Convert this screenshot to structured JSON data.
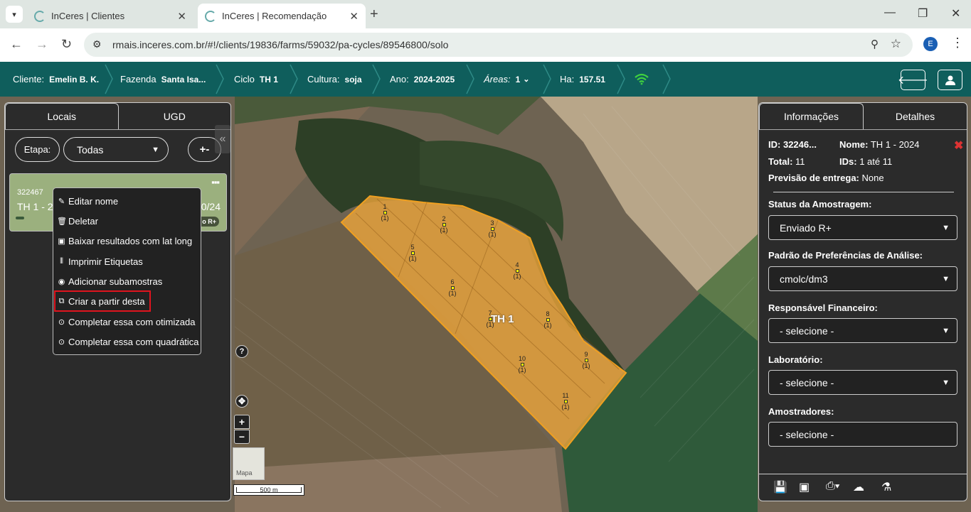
{
  "browser": {
    "tabs": [
      {
        "title": "InCeres | Clientes"
      },
      {
        "title": "InCeres | Recomendação"
      }
    ],
    "url": "rmais.inceres.com.br/#!/clients/19836/farms/59032/pa-cycles/89546800/solo",
    "profile_initial": "E"
  },
  "header": {
    "cliente_label": "Cliente:",
    "cliente_value": "Emelin B. K.",
    "fazenda_label": "Fazenda",
    "fazenda_value": "Santa Isa...",
    "ciclo_label": "Ciclo",
    "ciclo_value": "TH 1",
    "cultura_label": "Cultura:",
    "cultura_value": "soja",
    "ano_label": "Ano:",
    "ano_value": "2024-2025",
    "areas_label": "Áreas:",
    "areas_value": "1",
    "ha_label": "Ha:",
    "ha_value": "157.51"
  },
  "left_panel": {
    "tabs": [
      "Locais",
      "UGD"
    ],
    "etapa_label": "Etapa:",
    "etapa_select": "Todas",
    "plus_label": "+-",
    "card": {
      "id": "322467",
      "name": "TH 1 - 20",
      "date": "0/24",
      "badge": "o R+"
    }
  },
  "context_menu": {
    "items": [
      {
        "label": "Editar nome",
        "icon": "pencil-icon"
      },
      {
        "label": "Deletar",
        "icon": "trash-icon"
      },
      {
        "label": "Baixar resultados com lat long",
        "icon": "excel-file-icon"
      },
      {
        "label": "Imprimir Etiquetas",
        "icon": "barcode-icon"
      },
      {
        "label": "Adicionar subamostras",
        "icon": "circle-dot-icon"
      },
      {
        "label": "Criar a partir desta",
        "icon": "copy-icon",
        "highlighted": true
      },
      {
        "label": "Completar essa com otimizada",
        "icon": "dot-circle-icon"
      },
      {
        "label": "Completar essa com quadrática",
        "icon": "dot-circle-icon"
      }
    ]
  },
  "map": {
    "field_label": "TH 1",
    "field_color": "#e8a23a",
    "points": [
      {
        "n": "1",
        "sub": "(1)"
      },
      {
        "n": "2",
        "sub": "(1)"
      },
      {
        "n": "3",
        "sub": "(1)"
      },
      {
        "n": "4",
        "sub": "(1)"
      },
      {
        "n": "5",
        "sub": "(1)"
      },
      {
        "n": "6",
        "sub": "(1)"
      },
      {
        "n": "7",
        "sub": "(1)"
      },
      {
        "n": "8",
        "sub": "(1)"
      },
      {
        "n": "9",
        "sub": "(1)"
      },
      {
        "n": "10",
        "sub": "(1)"
      },
      {
        "n": "11",
        "sub": "(1)"
      }
    ],
    "thumb_label": "Mapa",
    "scale_label": "500 m",
    "help": "?"
  },
  "right_panel": {
    "tabs": [
      "Informações",
      "Detalhes"
    ],
    "id_label": "ID:",
    "id_value": "32246...",
    "nome_label": "Nome:",
    "nome_value": "TH 1 - 2024",
    "total_label": "Total:",
    "total_value": "11",
    "ids_label": "IDs:",
    "ids_value": "1 até 11",
    "previsao_label": "Previsão de entrega:",
    "previsao_value": "None",
    "fields": [
      {
        "label": "Status da Amostragem:",
        "value": "Enviado R+"
      },
      {
        "label": "Padrão de Preferências de Análise:",
        "value": "cmolc/dm3"
      },
      {
        "label": "Responsável Financeiro:",
        "value": "- selecione -"
      },
      {
        "label": "Laboratório:",
        "value": "- selecione -"
      },
      {
        "label": "Amostradores:",
        "value": "- selecione -"
      }
    ]
  }
}
